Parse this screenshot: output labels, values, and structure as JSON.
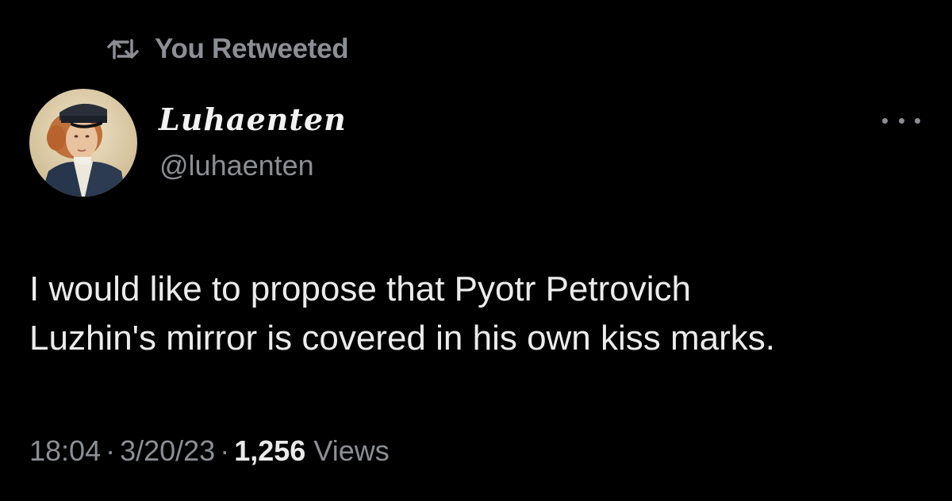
{
  "retweet_banner": {
    "icon": "retweet-icon",
    "label": "You Retweeted"
  },
  "author": {
    "display_name": "Luhaenten",
    "handle": "@luhaenten",
    "avatar": "avatar-portrait-sailor-cap"
  },
  "more_icon": "more-options-icon",
  "tweet": {
    "text_lines": [
      "I would like to propose that Pyotr Petrovich",
      "Luzhin's mirror is covered in his own kiss marks."
    ]
  },
  "meta": {
    "time": "18:04",
    "separator": "·",
    "date": "3/20/23",
    "views_count": "1,256",
    "views_label": "Views"
  },
  "colors": {
    "background": "#000000",
    "primary_text": "#e7e9ea",
    "secondary_text": "#8b8f94"
  }
}
